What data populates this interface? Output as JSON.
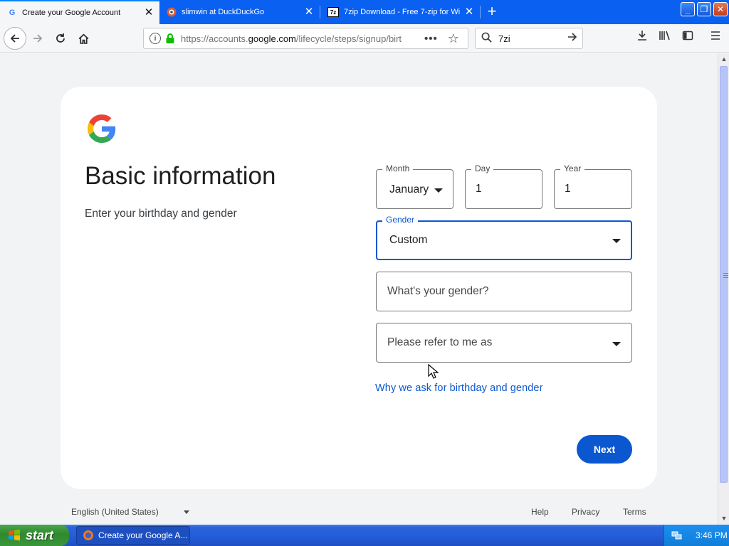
{
  "browser": {
    "tabs": [
      {
        "title": "Create your Google Account",
        "favicon": "G",
        "active": true
      },
      {
        "title": "slimwin at DuckDuckGo",
        "favicon": "duckduckgo-icon",
        "active": false
      },
      {
        "title": "7zip Download - Free 7-zip for Wi",
        "favicon": "7z",
        "active": false
      }
    ],
    "url_prefix": "https://accounts.",
    "url_domain": "google.com",
    "url_suffix": "/lifecycle/steps/signup/birt",
    "search_query": "7zi"
  },
  "page": {
    "heading": "Basic information",
    "subheading": "Enter your birthday and gender",
    "month": {
      "label": "Month",
      "value": "January"
    },
    "day": {
      "label": "Day",
      "value": "1"
    },
    "year": {
      "label": "Year",
      "value": "1"
    },
    "gender": {
      "label": "Gender",
      "value": "Custom"
    },
    "custom_gender_placeholder": "What's your gender?",
    "pronoun_placeholder": "Please refer to me as",
    "why_link": "Why we ask for birthday and gender",
    "next_label": "Next"
  },
  "footer": {
    "language": "English (United States)",
    "help": "Help",
    "privacy": "Privacy",
    "terms": "Terms"
  },
  "taskbar": {
    "start_label": "start",
    "task_title": "Create your Google A...",
    "clock": "3:46 PM"
  },
  "colors": {
    "google_blue": "#0b57d0",
    "page_bg": "#f1f3f4",
    "tabstrip": "#0a60f0"
  }
}
